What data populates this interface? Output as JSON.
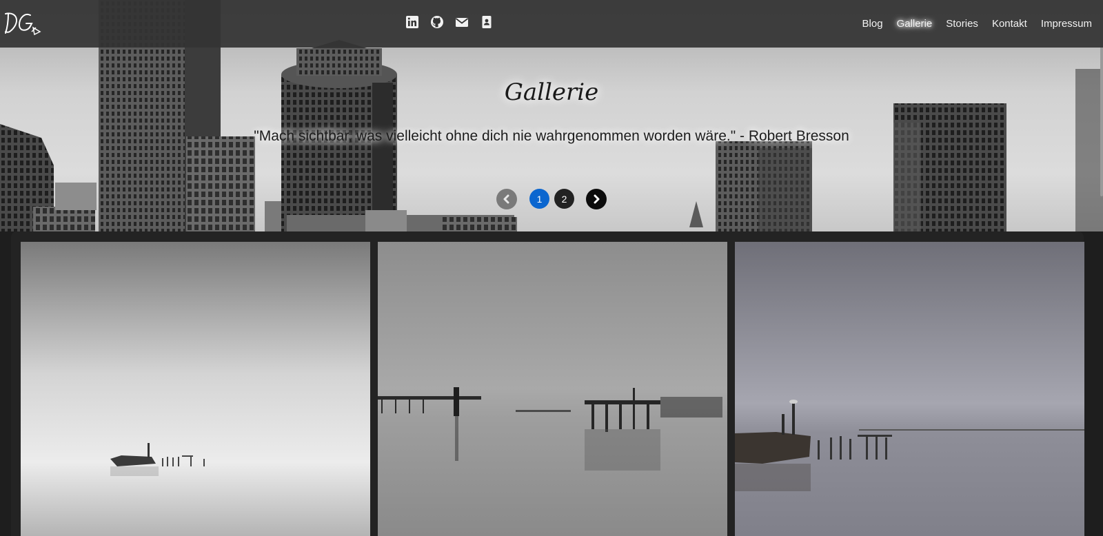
{
  "brand": {
    "logo_text": "DG"
  },
  "social": [
    {
      "name": "linkedin-icon"
    },
    {
      "name": "github-icon"
    },
    {
      "name": "email-icon"
    },
    {
      "name": "contact-card-icon"
    }
  ],
  "nav": {
    "items": [
      {
        "label": "Blog"
      },
      {
        "label": "Gallerie",
        "active": true
      },
      {
        "label": "Stories"
      },
      {
        "label": "Kontakt"
      },
      {
        "label": "Impressum"
      }
    ]
  },
  "hero": {
    "title": "Gallerie",
    "quote": "\"Mach sichtbar, was vielleicht ohne dich nie wahrgenommen worden wäre.\" - Robert Bresson"
  },
  "pagination": {
    "pages": [
      "1",
      "2"
    ],
    "current": "1"
  },
  "colors": {
    "navbar": "#343434",
    "active_page": "#0b66cf",
    "gallery_bg": "#232323"
  }
}
